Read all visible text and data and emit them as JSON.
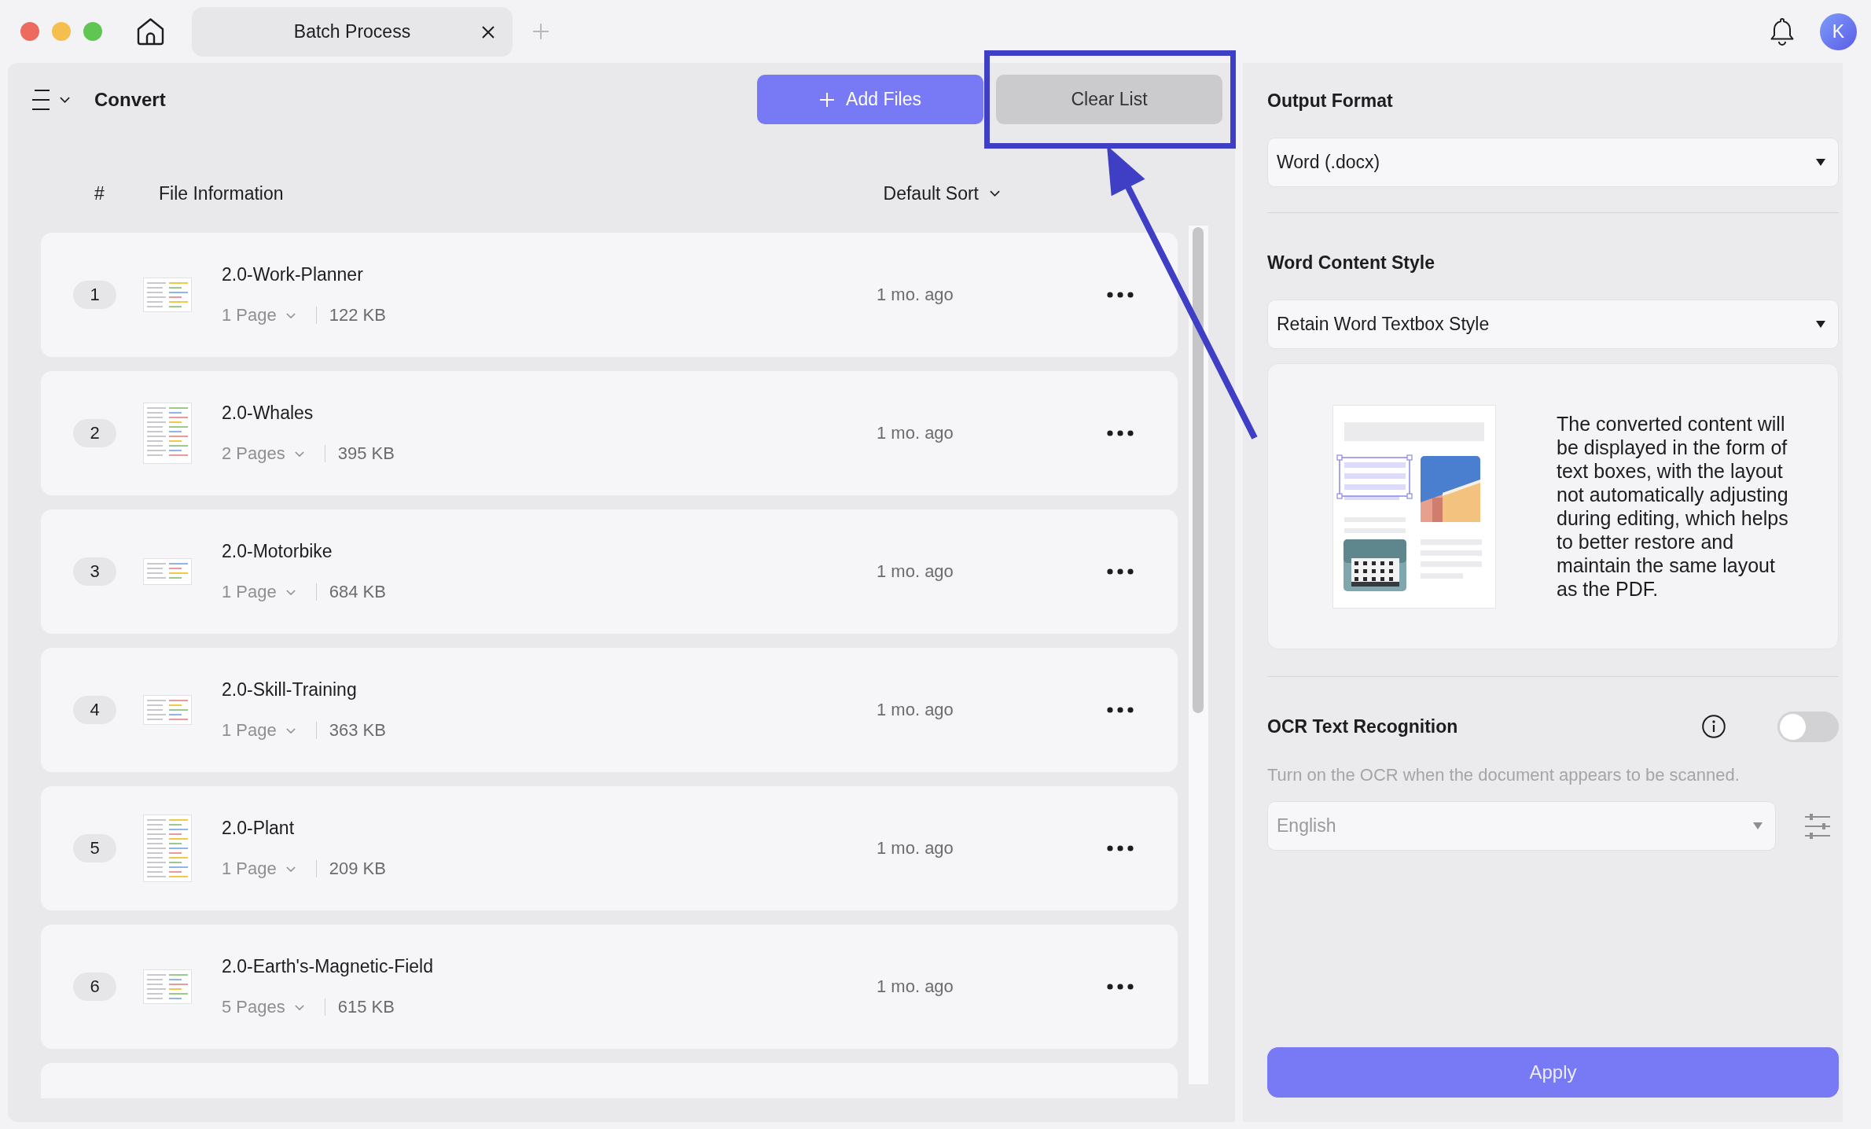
{
  "titlebar": {
    "tabs": [
      {
        "label": "Batch Process",
        "selected": true
      }
    ],
    "avatar": "K"
  },
  "toolbar": {
    "title": "Convert",
    "buttons": [
      {
        "label": "Add Files",
        "kind": "primary",
        "highlighted": false
      },
      {
        "label": "Clear List",
        "kind": "secondary",
        "highlighted": true
      }
    ]
  },
  "table": {
    "columns": [
      {
        "label": "#"
      },
      {
        "label": "File Information"
      }
    ],
    "sort": "Default Sort",
    "rows": [
      {
        "index": "1",
        "name": "2.0-Work-Planner",
        "pages": "1 Page",
        "size": "122 KB",
        "modified": "1 mo. ago"
      },
      {
        "index": "2",
        "name": "2.0-Whales",
        "pages": "2 Pages",
        "size": "395 KB",
        "modified": "1 mo. ago"
      },
      {
        "index": "3",
        "name": "2.0-Motorbike",
        "pages": "1 Page",
        "size": "684 KB",
        "modified": "1 mo. ago"
      },
      {
        "index": "4",
        "name": "2.0-Skill-Training",
        "pages": "1 Page",
        "size": "363 KB",
        "modified": "1 mo. ago"
      },
      {
        "index": "5",
        "name": "2.0-Plant",
        "pages": "1 Page",
        "size": "209 KB",
        "modified": "1 mo. ago"
      },
      {
        "index": "6",
        "name": "2.0-Earth's-Magnetic-Field",
        "pages": "5 Pages",
        "size": "615 KB",
        "modified": "1 mo. ago"
      }
    ],
    "more_below": true
  },
  "settings": {
    "output_format": {
      "label": "Output Format",
      "value": "Word (.docx)"
    },
    "content_style": {
      "label": "Word Content Style",
      "value": "Retain Word Textbox Style",
      "description": "The converted content will be displayed in the form of text boxes, with the layout not automatically adjusting during editing, which helps to better restore and maintain the same layout as the PDF."
    },
    "ocr": {
      "label": "OCR Text Recognition",
      "on": false,
      "hint": "Turn on the OCR when the document appears to be scanned.",
      "language": {
        "value": "English",
        "disabled": true
      }
    },
    "apply": "Apply"
  }
}
